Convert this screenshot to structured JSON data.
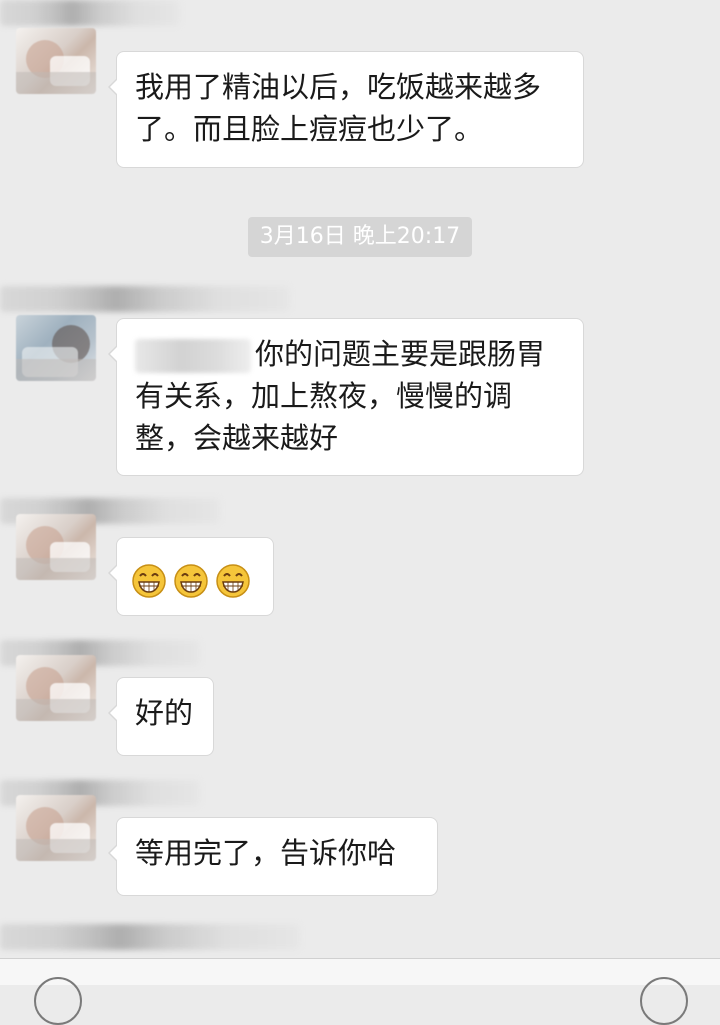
{
  "timestamp": "3月16日 晚上20:17",
  "messages": [
    {
      "text": "我用了精油以后，吃饭越来越多了。而且脸上痘痘也少了。"
    },
    {
      "mention": "",
      "text": "你的问题主要是跟肠胃有关系，加上熬夜，慢慢的调整，会越来越好"
    },
    {
      "emojis": [
        "grin-emoji",
        "grin-emoji",
        "grin-emoji"
      ]
    },
    {
      "text": "好的"
    },
    {
      "text": "等用完了，告诉你哈"
    }
  ],
  "colors": {
    "background": "#ebebeb",
    "bubble": "#ffffff",
    "timestamp_bg": "#d5d5d5",
    "emoji": "#f5c53a"
  }
}
